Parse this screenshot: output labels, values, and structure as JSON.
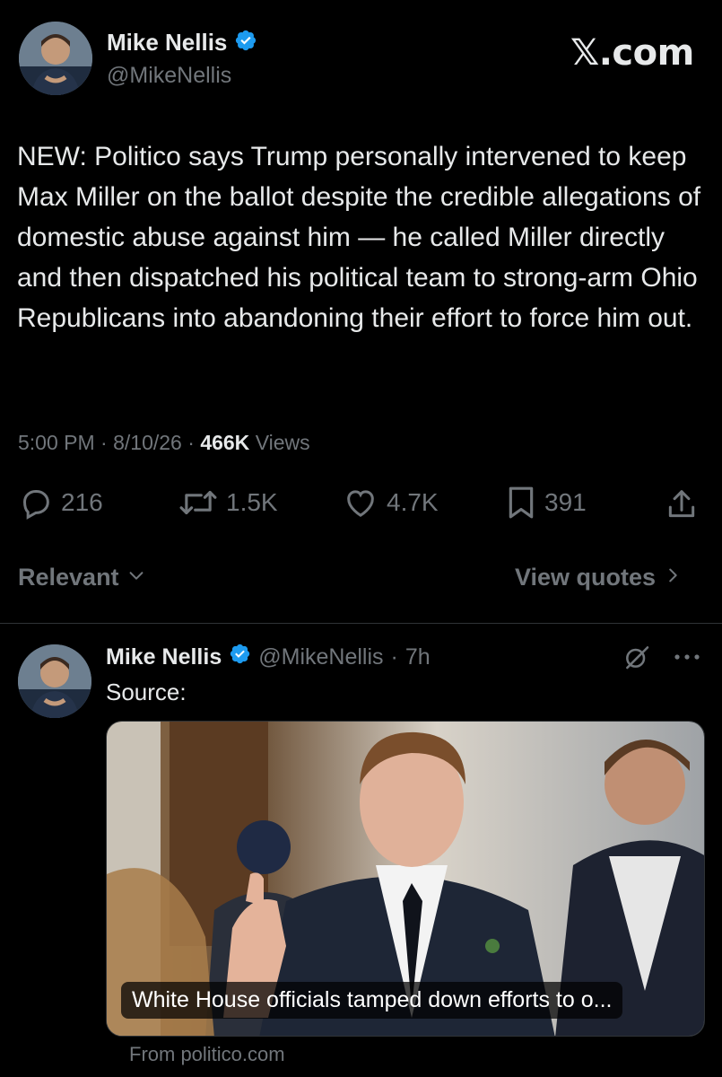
{
  "main_tweet": {
    "author_name": "Mike Nellis",
    "author_handle": "@MikeNellis",
    "brand": "𝕏.com",
    "text": "NEW: Politico says Trump personally intervened to keep Max Miller on the ballot despite the credible allegations of domestic abuse against him — he called Miller directly and then dispatched his political team to strong-arm Ohio Republicans into abandoning their effort to force him out.",
    "time": "5:00 PM",
    "date": "8/10/26",
    "views_count": "466K",
    "views_label": "Views",
    "replies": "216",
    "reposts": "1.5K",
    "likes": "4.7K",
    "bookmarks": "391"
  },
  "sort_bar": {
    "relevant_label": "Relevant",
    "view_quotes_label": "View quotes"
  },
  "reply": {
    "author_name": "Mike Nellis",
    "author_handle": "@MikeNellis",
    "age": "7h",
    "text": "Source:",
    "link_caption": "White House officials tamped down efforts to o...",
    "link_source": "From politico.com"
  },
  "colors": {
    "background": "#000000",
    "text": "#e7e9ea",
    "secondary": "#71767b",
    "verified": "#1d9bf0",
    "divider": "#2f3336"
  },
  "icons": [
    "verified-badge-icon",
    "reply-icon",
    "repost-icon",
    "like-icon",
    "bookmark-icon",
    "share-icon",
    "chevron-down-icon",
    "chevron-right-icon",
    "grok-icon",
    "more-icon"
  ]
}
